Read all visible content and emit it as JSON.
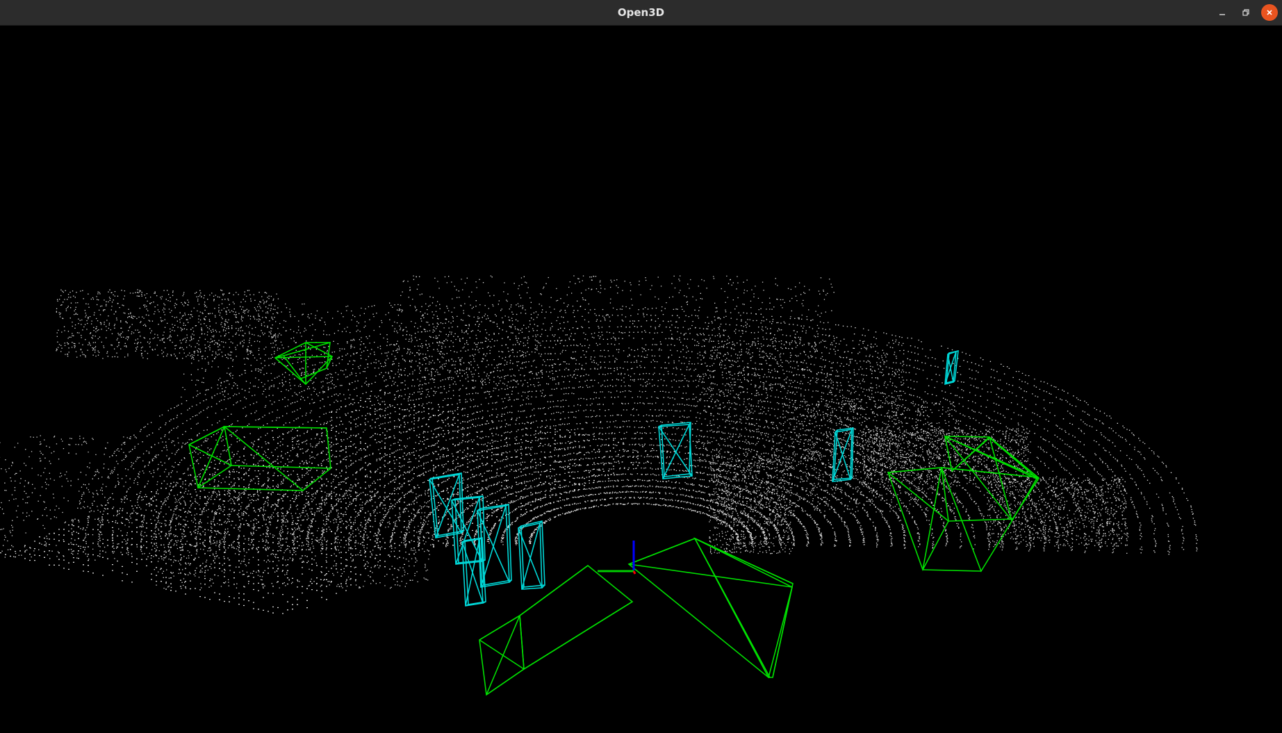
{
  "window": {
    "title": "Open3D",
    "controls": [
      "minimize-icon",
      "restore-icon",
      "close-icon"
    ]
  },
  "scene": {
    "background_color": "#000000",
    "point_color": "#ffffff",
    "car_box_color": "#00e000",
    "pedestrian_box_color": "#00d8d8",
    "axis_colors": {
      "x": "#ff0000",
      "y": "#00cc00",
      "z": "#0000ff"
    }
  },
  "titlebar_color": "#2c2c2c",
  "close_button_color": "#e95420"
}
